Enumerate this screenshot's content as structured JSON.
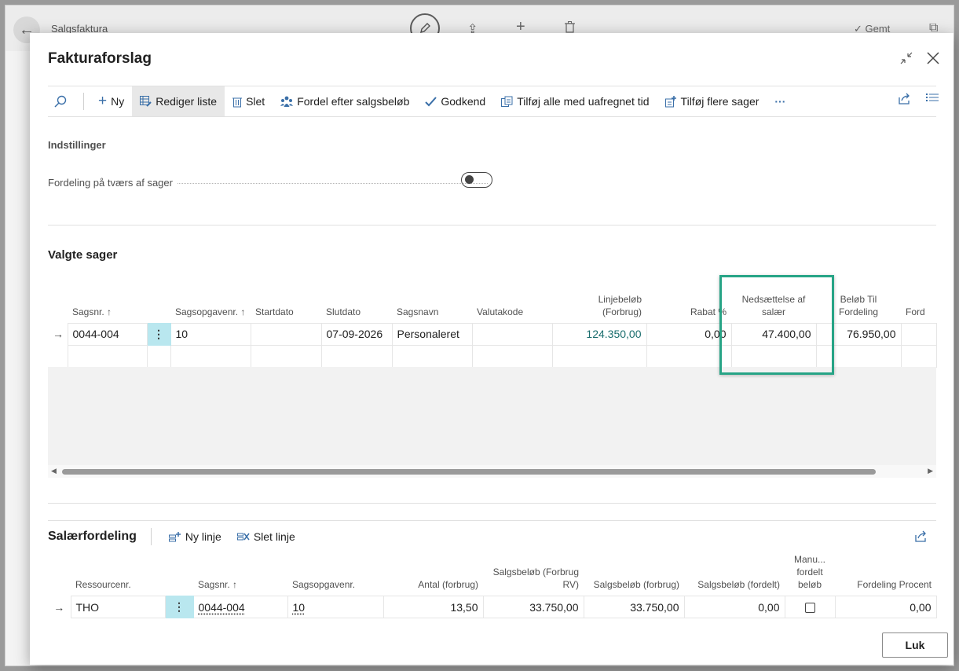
{
  "background": {
    "title": "Salgsfaktura",
    "saved_label": "Gemt"
  },
  "dialog": {
    "title": "Fakturaforslag"
  },
  "actions": {
    "new": "Ny",
    "edit_list": "Rediger liste",
    "delete": "Slet",
    "distribute": "Fordel efter salgsbeløb",
    "approve": "Godkend",
    "add_all_unbilled": "Tilføj alle med uafregnet tid",
    "add_more_jobs": "Tilføj flere sager",
    "more": "···"
  },
  "settings": {
    "heading": "Indstillinger",
    "cross_job_label": "Fordeling på tværs af sager",
    "cross_job_enabled": false
  },
  "jobs": {
    "heading": "Valgte sager",
    "columns": {
      "job_no": "Sagsnr. ↑",
      "task_no": "Sagsopgavenr. ↑",
      "start_date": "Startdato",
      "end_date": "Slutdato",
      "job_name": "Sagsnavn",
      "currency": "Valutakode",
      "line_amount": "Linjebeløb (Forbrug)",
      "discount": "Rabat %",
      "fee_reduction": "Nedsættelse af salær",
      "amount_to_distribute": "Beløb Til Fordeling",
      "distribution": "Ford"
    },
    "rows": [
      {
        "job_no": "0044-004",
        "task_no": "10",
        "start_date": "",
        "end_date": "07-09-2026",
        "job_name": "Personaleret",
        "currency": "",
        "line_amount": "124.350,00",
        "discount": "0,00",
        "fee_reduction": "47.400,00",
        "amount_to_distribute": "76.950,00",
        "distribution": ""
      }
    ]
  },
  "fees": {
    "heading": "Salærfordeling",
    "new_line": "Ny linje",
    "delete_line": "Slet linje",
    "columns": {
      "resource": "Ressourcenr.",
      "job_no": "Sagsnr. ↑",
      "task_no": "Sagsopgavenr.",
      "quantity": "Antal (forbrug)",
      "sales_amount_rv": "Salgsbeløb (Forbrug RV)",
      "sales_amount": "Salgsbeløb (forbrug)",
      "sales_amount_distributed": "Salgsbeløb (fordelt)",
      "manual_amount": "Manu... fordelt beløb",
      "distribution_pct": "Fordeling Procent"
    },
    "rows": [
      {
        "resource": "THO",
        "job_no": "0044-004",
        "task_no": "10",
        "quantity": "13,50",
        "sales_amount_rv": "33.750,00",
        "sales_amount": "33.750,00",
        "sales_amount_distributed": "0,00",
        "manual_amount": false,
        "distribution_pct": "0,00"
      }
    ]
  },
  "footer": {
    "close_label": "Luk"
  },
  "colors": {
    "accent": "#3a6fa8",
    "highlight": "#27a486",
    "link": "#1a6d6d",
    "row_menu": "#b9e7ef"
  }
}
